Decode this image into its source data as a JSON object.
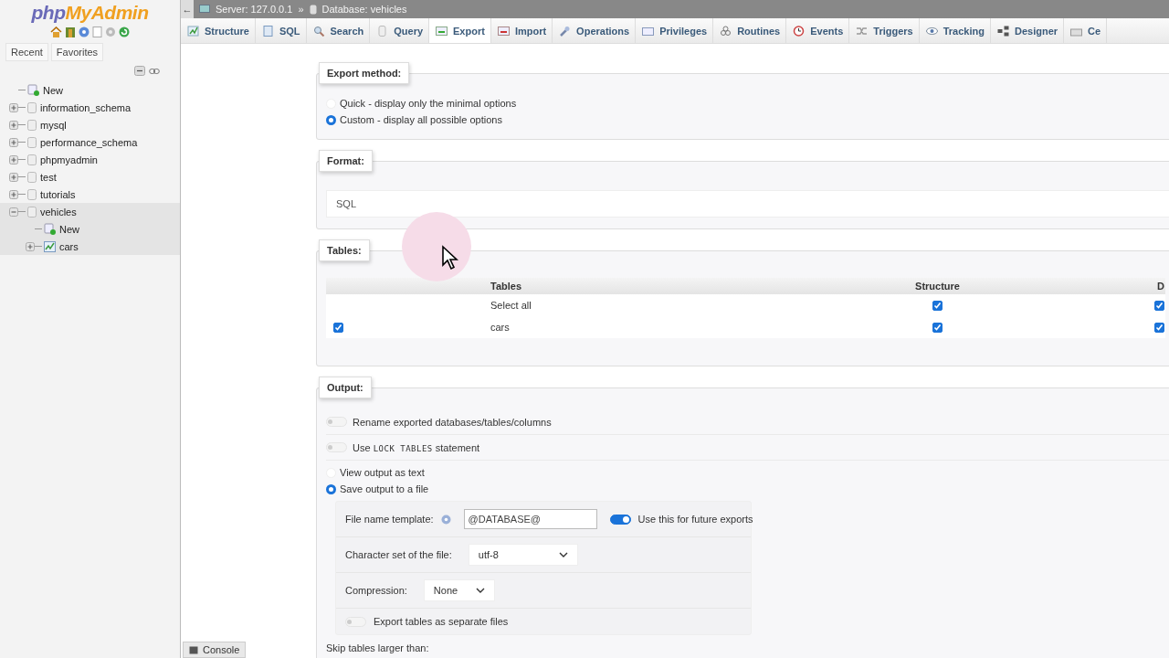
{
  "sidebar": {
    "logo": [
      "php",
      "MyAdmin"
    ],
    "tabs": [
      {
        "label": "Recent"
      },
      {
        "label": "Favorites"
      }
    ],
    "tree": [
      {
        "label": "New",
        "kind": "new",
        "selected": false
      },
      {
        "label": "information_schema",
        "kind": "database",
        "expanded": false,
        "selected": false
      },
      {
        "label": "mysql",
        "kind": "database",
        "expanded": false,
        "selected": false
      },
      {
        "label": "performance_schema",
        "kind": "database",
        "expanded": false,
        "selected": false
      },
      {
        "label": "phpmyadmin",
        "kind": "database",
        "expanded": false,
        "selected": false
      },
      {
        "label": "test",
        "kind": "database",
        "expanded": false,
        "selected": false
      },
      {
        "label": "tutorials",
        "kind": "database",
        "expanded": false,
        "selected": false
      },
      {
        "label": "vehicles",
        "kind": "database",
        "expanded": true,
        "selected": true,
        "children": [
          {
            "label": "New",
            "kind": "new",
            "selected": true
          },
          {
            "label": "cars",
            "kind": "table",
            "expanded": false,
            "selected": true
          }
        ]
      }
    ]
  },
  "breadcrumb": {
    "back": "←",
    "items": [
      "Server: 127.0.0.1",
      "Database: vehicles"
    ],
    "separator": "»"
  },
  "tabs": [
    {
      "label": "Structure",
      "selected": false
    },
    {
      "label": "SQL",
      "selected": false
    },
    {
      "label": "Search",
      "selected": false
    },
    {
      "label": "Query",
      "selected": false
    },
    {
      "label": "Export",
      "selected": true
    },
    {
      "label": "Import",
      "selected": false
    },
    {
      "label": "Operations",
      "selected": false
    },
    {
      "label": "Privileges",
      "selected": false
    },
    {
      "label": "Routines",
      "selected": false
    },
    {
      "label": "Events",
      "selected": false
    },
    {
      "label": "Triggers",
      "selected": false
    },
    {
      "label": "Tracking",
      "selected": false
    },
    {
      "label": "Designer",
      "selected": false
    },
    {
      "label": "Ce",
      "selected": false
    }
  ],
  "export_method": {
    "legend": "Export method:",
    "options": [
      {
        "label": "Quick - display only the minimal options",
        "selected": false
      },
      {
        "label": "Custom - display all possible options",
        "selected": true
      }
    ]
  },
  "format": {
    "legend": "Format:",
    "value": "SQL"
  },
  "tables": {
    "legend": "Tables:",
    "columns": [
      "",
      "Tables",
      "Structure",
      "D"
    ],
    "rows": [
      {
        "kind": "select_all",
        "checked": false,
        "name": "Select all",
        "structure": true,
        "data": true
      },
      {
        "kind": "table",
        "checked": true,
        "name": "cars",
        "structure": true,
        "data": true
      }
    ]
  },
  "output": {
    "legend": "Output:",
    "rename": {
      "label": "Rename exported databases/tables/columns",
      "on": false
    },
    "lock": {
      "parts": [
        {
          "kind": "text",
          "text": "Use "
        },
        {
          "kind": "code",
          "text": "LOCK TABLES"
        },
        {
          "kind": "text",
          "text": " statement"
        }
      ],
      "on": false
    },
    "modes": [
      {
        "label": "View output as text",
        "selected": false
      },
      {
        "label": "Save output to a file",
        "selected": true
      }
    ],
    "file": {
      "template_label": "File name template:",
      "template_value": "@DATABASE@",
      "remember_label": "Use this for future exports",
      "remember_on": true,
      "charset_label": "Character set of the file:",
      "charset_value": "utf-8",
      "compression_label": "Compression:",
      "compression_value": "None",
      "separate_label": "Export tables as separate files",
      "separate_on": false
    },
    "skip_label": "Skip tables larger than:"
  },
  "console": {
    "label": "Console"
  }
}
